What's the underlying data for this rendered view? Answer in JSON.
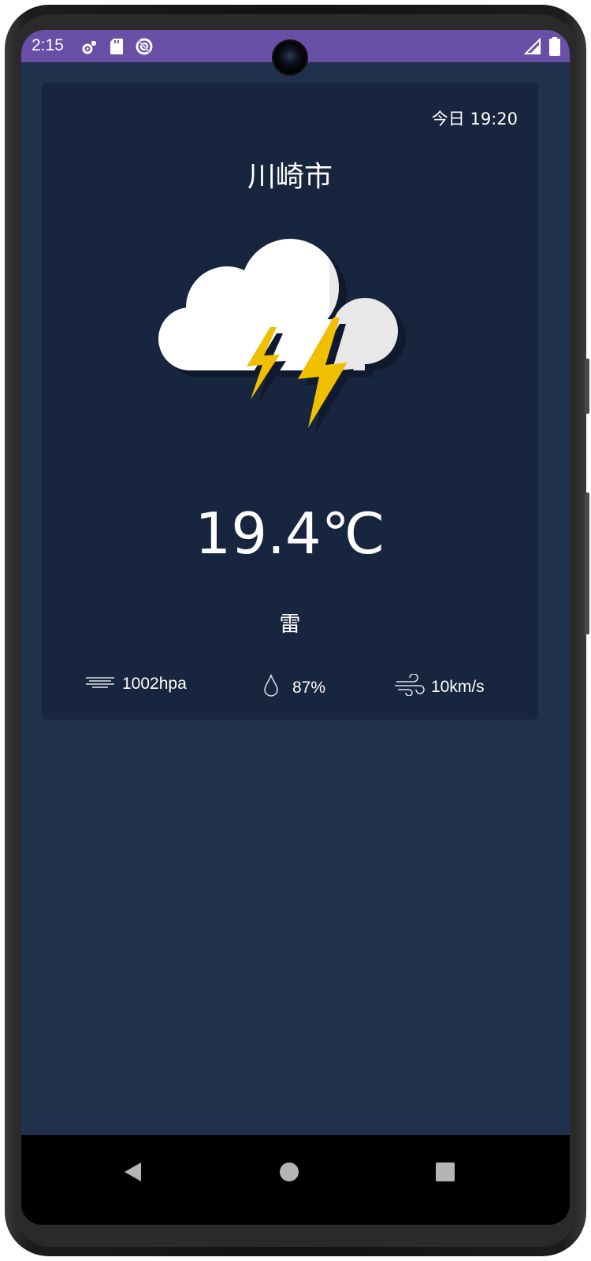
{
  "status_bar": {
    "time": "2:15",
    "left_icons": [
      "settings-icon",
      "sd-card-icon",
      "sync-icon"
    ],
    "right_icons": [
      "signal-icon",
      "battery-icon"
    ],
    "color": "#6a4fa6"
  },
  "weather": {
    "datetime": "今日 19:20",
    "city": "川崎市",
    "icon": "thunderstorm-icon",
    "temperature": "19.4℃",
    "condition": "雷",
    "pressure": "1002hpa",
    "humidity": "87%",
    "wind": "10km/s"
  },
  "navigation": {
    "buttons": [
      "back-button",
      "home-button",
      "recents-button"
    ]
  },
  "colors": {
    "background": "#20314e",
    "card": "#17253e",
    "lightning": "#f0c000",
    "cloud": "#ffffff"
  }
}
